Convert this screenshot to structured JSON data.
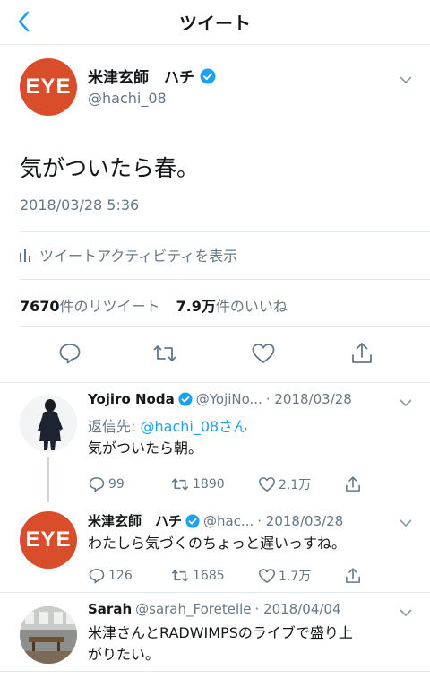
{
  "nav": {
    "title": "ツイート"
  },
  "main_tweet": {
    "avatar_text": "EYE",
    "name": "米津玄師　ハチ",
    "handle": "@hachi_08",
    "text": "気がついたら春。",
    "timestamp": "2018/03/28 5:36",
    "activity_label": "ツイートアクティビティを表示",
    "retweet_count": "7670",
    "retweet_label": "件のリツイート",
    "like_count": "7.9万",
    "like_label": "件のいいね"
  },
  "replies": [
    {
      "name": "Yojiro Noda",
      "handle": "@YojiNo...",
      "date": "· 2018/03/28",
      "replying_prefix": "返信先:",
      "replying_to": "@hachi_08さん",
      "text": "気がついたら朝。",
      "reply_count": "99",
      "retweet_count": "1890",
      "like_count": "2.1万"
    },
    {
      "avatar_text": "EYE",
      "name": "米津玄師　ハチ",
      "handle": "@hac...",
      "date": "· 2018/03/28",
      "text": "わたしら気づくのちょっと遅いっすね。",
      "reply_count": "126",
      "retweet_count": "1685",
      "like_count": "1.7万"
    },
    {
      "name": "Sarah",
      "handle": "@sarah_Foretelle",
      "date": "· 2018/04/04",
      "text_line1": "米津さんとRADWIMPSのライブで盛り上",
      "text_line2": "がりたい。"
    }
  ],
  "colors": {
    "accent": "#1da1f2",
    "muted": "#657786",
    "eye_red": "#d94d2b",
    "divider": "#e1e8ed"
  }
}
